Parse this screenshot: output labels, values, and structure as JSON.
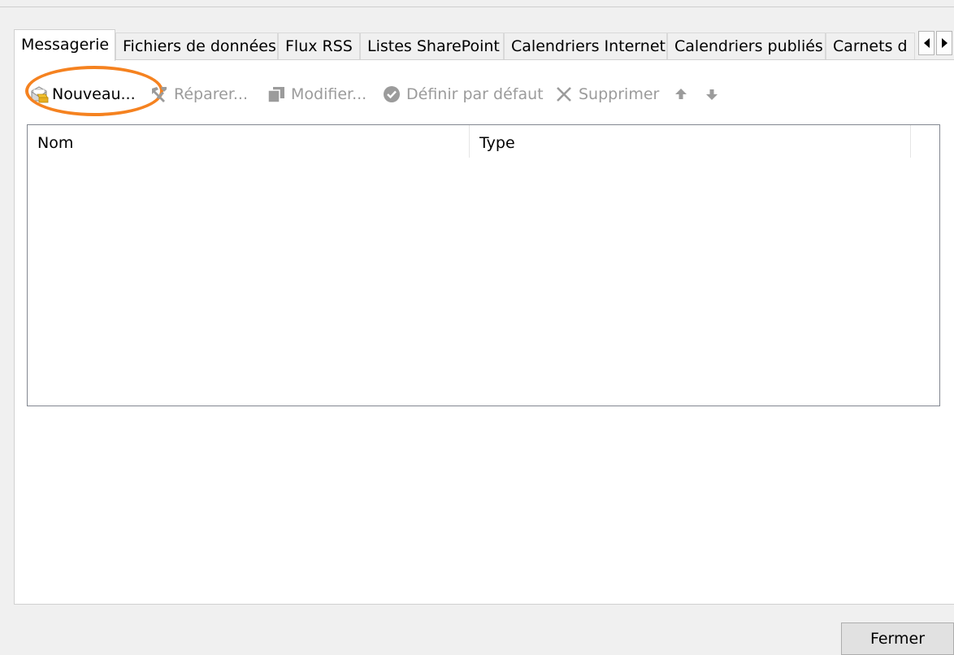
{
  "tabs": [
    {
      "label": "Messagerie",
      "active": true
    },
    {
      "label": "Fichiers de données"
    },
    {
      "label": "Flux RSS"
    },
    {
      "label": "Listes SharePoint"
    },
    {
      "label": "Calendriers Internet"
    },
    {
      "label": "Calendriers publiés"
    },
    {
      "label": "Carnets d"
    }
  ],
  "toolbar": {
    "new_label": "Nouveau...",
    "repair_label": "Réparer...",
    "modify_label": "Modifier...",
    "set_default_label": "Définir par défaut",
    "delete_label": "Supprimer"
  },
  "list": {
    "columns": [
      "Nom",
      "Type"
    ]
  },
  "footer": {
    "close_label": "Fermer"
  },
  "colors": {
    "highlight_ring": "#f58220",
    "disabled_text": "#9b9b9b"
  },
  "icons": [
    "new-account-icon",
    "repair-icon",
    "modify-icon",
    "set-default-icon",
    "delete-icon",
    "arrow-up-icon",
    "arrow-down-icon",
    "scroll-left-icon",
    "scroll-right-icon"
  ]
}
